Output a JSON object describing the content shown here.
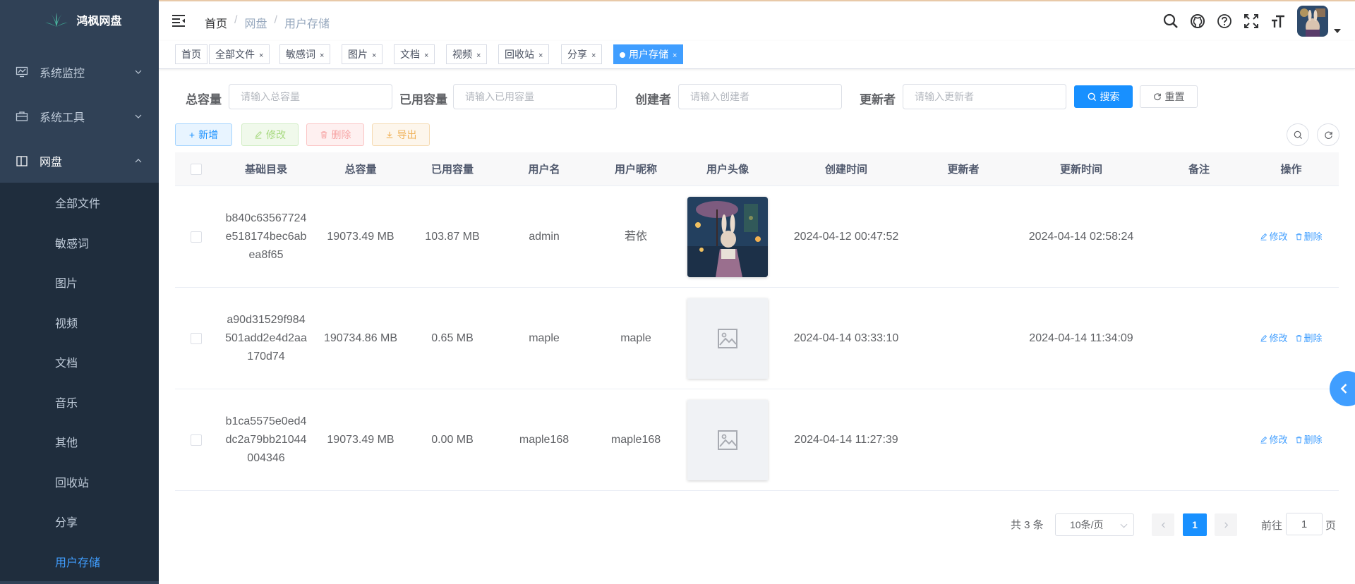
{
  "app": {
    "title": "鸿枫网盘"
  },
  "sidebar": {
    "menus": [
      {
        "label": "系统监控",
        "icon": "monitor-icon"
      },
      {
        "label": "系统工具",
        "icon": "toolbox-icon"
      },
      {
        "label": "网盘",
        "icon": "book-icon"
      }
    ],
    "submenu": [
      "全部文件",
      "敏感词",
      "图片",
      "视频",
      "文档",
      "音乐",
      "其他",
      "回收站",
      "分享",
      "用户存储"
    ],
    "active": "用户存储"
  },
  "breadcrumb": [
    "首页",
    "网盘",
    "用户存储"
  ],
  "tags": [
    {
      "label": "首页",
      "closable": false
    },
    {
      "label": "全部文件",
      "closable": true
    },
    {
      "label": "敏感词",
      "closable": true
    },
    {
      "label": "图片",
      "closable": true
    },
    {
      "label": "文档",
      "closable": true
    },
    {
      "label": "视频",
      "closable": true
    },
    {
      "label": "回收站",
      "closable": true
    },
    {
      "label": "分享",
      "closable": true
    },
    {
      "label": "用户存储",
      "closable": true,
      "active": true
    }
  ],
  "search": {
    "total_label": "总容量",
    "total_placeholder": "请输入总容量",
    "used_label": "已用容量",
    "used_placeholder": "请输入已用容量",
    "creator_label": "创建者",
    "creator_placeholder": "请输入创建者",
    "updater_label": "更新者",
    "updater_placeholder": "请输入更新者",
    "search_btn": "搜索",
    "reset_btn": "重置"
  },
  "toolbar": {
    "add": "新增",
    "edit": "修改",
    "delete": "删除",
    "export": "导出"
  },
  "table": {
    "headers": [
      "基础目录",
      "总容量",
      "已用容量",
      "用户名",
      "用户昵称",
      "用户头像",
      "创建时间",
      "更新者",
      "更新时间",
      "备注",
      "操作"
    ],
    "rows": [
      {
        "dir_1": "b840c63567724",
        "dir_2": "e518174bec6ab",
        "dir_3": "ea8f65",
        "total": "19073.49 MB",
        "used": "103.87 MB",
        "username": "admin",
        "nickname": "若依",
        "has_avatar": true,
        "created": "2024-04-12 00:47:52",
        "updater": "",
        "updated": "2024-04-14 02:58:24",
        "remark": ""
      },
      {
        "dir_1": "a90d31529f984",
        "dir_2": "501add2e4d2aa",
        "dir_3": "170d74",
        "total": "190734.86 MB",
        "used": "0.65 MB",
        "username": "maple",
        "nickname": "maple",
        "has_avatar": false,
        "created": "2024-04-14 03:33:10",
        "updater": "",
        "updated": "2024-04-14 11:34:09",
        "remark": ""
      },
      {
        "dir_1": "b1ca5575e0ed4",
        "dir_2": "dc2a79bb21044",
        "dir_3": "004346",
        "total": "19073.49 MB",
        "used": "0.00 MB",
        "username": "maple168",
        "nickname": "maple168",
        "has_avatar": false,
        "created": "2024-04-14 11:27:39",
        "updater": "",
        "updated": "",
        "remark": ""
      }
    ],
    "op_edit": "修改",
    "op_delete": "删除"
  },
  "pagination": {
    "total_text": "共 3 条",
    "page_size": "10条/页",
    "current": "1",
    "goto_prefix": "前往",
    "goto_value": "1",
    "goto_suffix": "页"
  },
  "colors": {
    "sidebar_bg": "#304156",
    "submenu_bg": "#1f2d3d",
    "primary": "#1890ff",
    "active_menu": "#409eff"
  }
}
